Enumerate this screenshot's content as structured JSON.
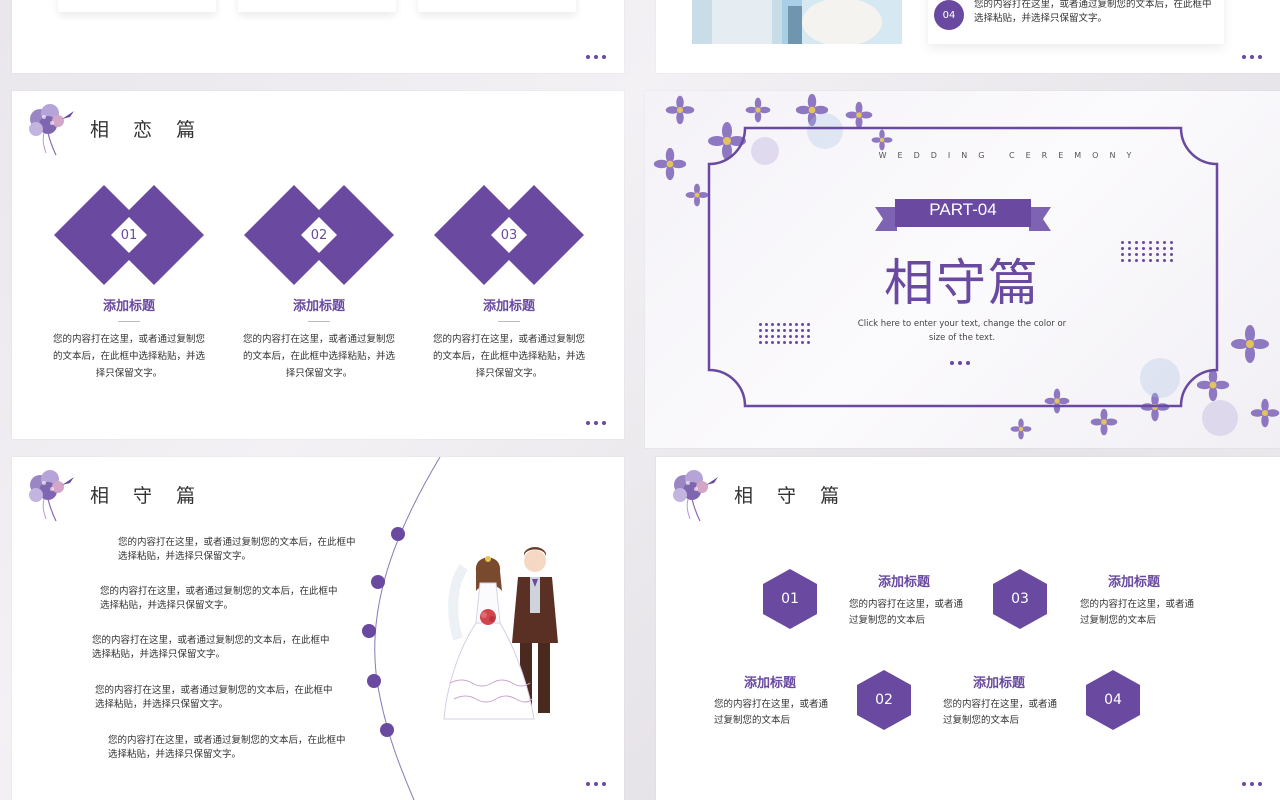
{
  "colors": {
    "accent": "#6a4aa0",
    "text": "#333333"
  },
  "slide_top_right": {
    "badge": "04",
    "text": "您的内容打在这里，或者通过复制您的文本后，在此框中选择粘贴，并选择只保留文字。"
  },
  "slide_xianglian": {
    "title": "相 恋 篇",
    "items": [
      {
        "num": "01",
        "title": "添加标题",
        "body": "您的内容打在这里，或者通过复制您的文本后，在此框中选择粘贴，并选择只保留文字。"
      },
      {
        "num": "02",
        "title": "添加标题",
        "body": "您的内容打在这里，或者通过复制您的文本后，在此框中选择粘贴，并选择只保留文字。"
      },
      {
        "num": "03",
        "title": "添加标题",
        "body": "您的内容打在这里，或者通过复制您的文本后，在此框中选择粘贴，并选择只保留文字。"
      }
    ]
  },
  "slide_part": {
    "eyebrow": "WEDDING CEREMONY",
    "part": "PART-04",
    "title": "相守篇",
    "subtitle": "Click here to enter your text, change the color or size of the text."
  },
  "slide_timeline": {
    "title": "相 守 篇",
    "items": [
      "您的内容打在这里，或者通过复制您的文本后，在此框中选择粘贴，并选择只保留文字。",
      "您的内容打在这里，或者通过复制您的文本后，在此框中选择粘贴，并选择只保留文字。",
      "您的内容打在这里，或者通过复制您的文本后，在此框中选择粘贴，并选择只保留文字。",
      "您的内容打在这里，或者通过复制您的文本后，在此框中选择粘贴，并选择只保留文字。",
      "您的内容打在这里，或者通过复制您的文本后，在此框中选择粘贴，并选择只保留文字。"
    ]
  },
  "slide_hex": {
    "title": "相 守 篇",
    "items": [
      {
        "num": "01",
        "title": "添加标题",
        "body": "您的内容打在这里，或者通过复制您的文本后"
      },
      {
        "num": "02",
        "title": "添加标题",
        "body": "您的内容打在这里，或者通过复制您的文本后"
      },
      {
        "num": "03",
        "title": "添加标题",
        "body": "您的内容打在这里，或者通过复制您的文本后"
      },
      {
        "num": "04",
        "title": "添加标题",
        "body": "您的内容打在这里，或者通过复制您的文本后"
      }
    ]
  }
}
